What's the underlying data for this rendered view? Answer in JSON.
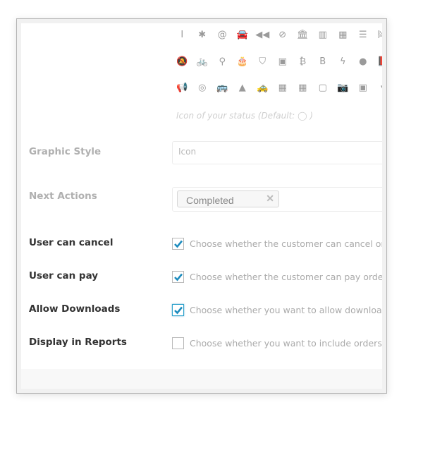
{
  "icon_picker": {
    "rows": [
      [
        "I-cursor-icon",
        "asterisk-icon",
        "at-icon",
        "car-icon",
        "backward-icon",
        "ban-icon",
        "bank-icon",
        "bar-chart-icon",
        "barcode-icon",
        "bars-icon",
        "bed-icon"
      ],
      [
        "bell-slash-icon",
        "bicycle-icon",
        "binoculars-icon",
        "birthday-cake-icon",
        "bitbucket-icon",
        "bitbucket-square-icon",
        "bitcoin-icon",
        "bold-icon",
        "bolt-icon",
        "bomb-icon",
        "book-icon"
      ],
      [
        "bullhorn-icon",
        "bullseye-icon",
        "bus-icon",
        "buysellads-icon",
        "cab-icon",
        "calculator-icon",
        "calendar-icon",
        "calendar-o-icon",
        "camera-icon",
        "camera-retro-icon",
        "caret-down-icon"
      ],
      [
        "cart-arrow-down-icon",
        "cart-plus-icon",
        "cc-icon",
        "cc-amex-icon",
        "cc-discover-icon",
        "cc-mastercard-icon",
        "cc-paypal-icon",
        "cc-stripe-icon",
        "cc-visa-icon",
        "certificate-icon"
      ]
    ],
    "glyphs": [
      [
        "I",
        "✱",
        "@",
        "🚘",
        "◀◀",
        "⊘",
        "🏛",
        "▥",
        "▦",
        "☰",
        "🛏"
      ],
      [
        "🔕",
        "🚲",
        "⚲",
        "🎂",
        "⛉",
        "▣",
        "₿",
        "B",
        "ϟ",
        "●",
        "📕"
      ],
      [
        "📢",
        "◎",
        "🚌",
        "▲",
        "🚕",
        "▦",
        "▦",
        "▢",
        "📷",
        "▣",
        "▾"
      ],
      [
        "▬",
        "▬",
        "▭",
        "▬",
        "▬",
        "▬",
        "▬",
        "▬",
        "▬",
        "▲"
      ]
    ],
    "hint": "Icon of your status (Default: ◯ )"
  },
  "graphic_style": {
    "label": "Graphic Style",
    "value": "Icon"
  },
  "next_actions": {
    "label": "Next Actions",
    "tags": [
      {
        "label": "Completed",
        "remove": "✕"
      }
    ]
  },
  "options": [
    {
      "label": "User can cancel",
      "checked": true,
      "description": "Choose whether the customer can cancel orders"
    },
    {
      "label": "User can pay",
      "checked": true,
      "description": "Choose whether the customer can pay orders wh"
    },
    {
      "label": "Allow Downloads",
      "checked": true,
      "focused": true,
      "description": "Choose whether you want to allow downloads wh"
    },
    {
      "label": "Display in Reports",
      "checked": false,
      "description": "Choose whether you want to include orders mark"
    }
  ],
  "colors": {
    "accent": "#1e8cbe",
    "focus": "#2ea2cc"
  }
}
